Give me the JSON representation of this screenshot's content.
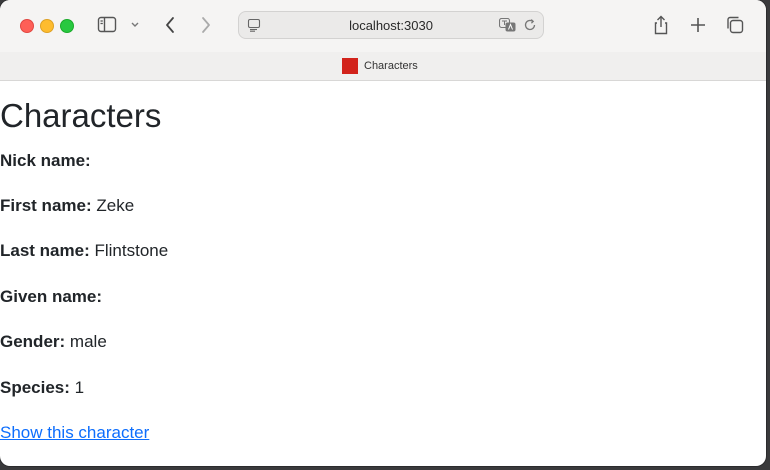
{
  "browser": {
    "url": "localhost:3030",
    "tab_title": "Characters",
    "favicon_color": "#d2231b"
  },
  "page": {
    "heading": "Characters",
    "fields": [
      {
        "label": "Nick name:",
        "value": ""
      },
      {
        "label": "First name:",
        "value": "Zeke"
      },
      {
        "label": "Last name:",
        "value": "Flintstone"
      },
      {
        "label": "Given name:",
        "value": ""
      },
      {
        "label": "Gender:",
        "value": "male"
      },
      {
        "label": "Species:",
        "value": "1"
      }
    ],
    "show_link": "Show this character"
  }
}
